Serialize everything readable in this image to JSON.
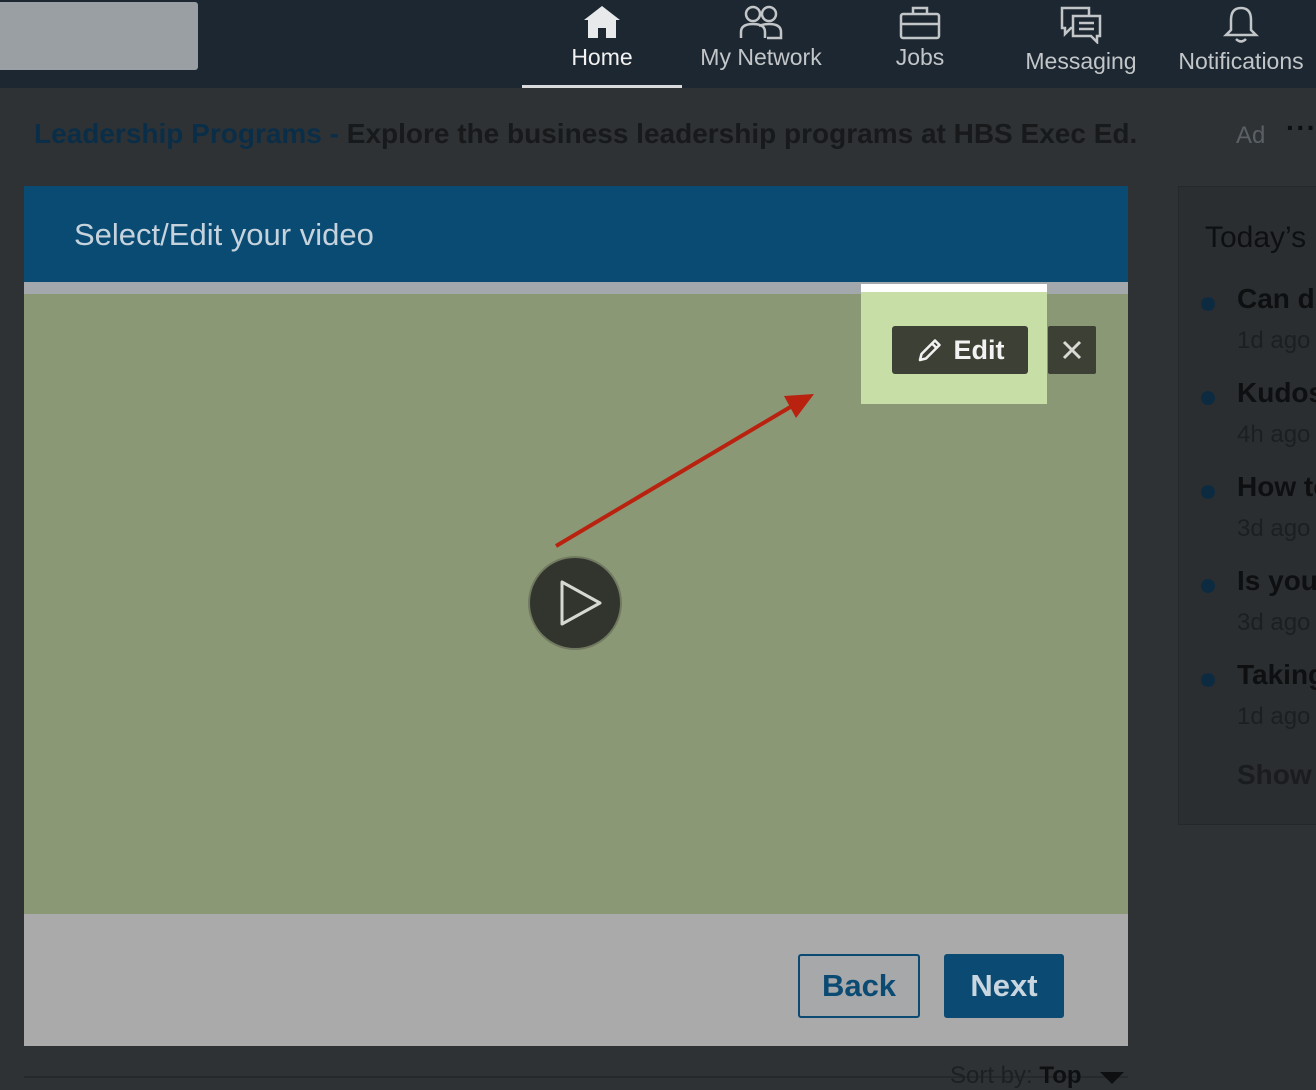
{
  "nav": {
    "items": [
      {
        "label": "Home",
        "icon": "home-icon",
        "active": true
      },
      {
        "label": "My Network",
        "icon": "network-icon"
      },
      {
        "label": "Jobs",
        "icon": "briefcase-icon"
      },
      {
        "label": "Messaging",
        "icon": "messaging-icon"
      },
      {
        "label": "Notifications",
        "icon": "bell-icon"
      }
    ]
  },
  "ad": {
    "link": "Leadership Programs",
    "separator": " - ",
    "text": "Explore the business leadership programs at HBS Exec Ed.",
    "label": "Ad",
    "more": "···"
  },
  "modal": {
    "title": "Select/Edit your video",
    "edit_label": "Edit",
    "back_label": "Back",
    "next_label": "Next"
  },
  "sidebar": {
    "title": "Today’s",
    "items": [
      {
        "headline": "Can dr",
        "meta": "1d ago"
      },
      {
        "headline": "Kudos",
        "meta": "4h ago"
      },
      {
        "headline": "How to",
        "meta": "3d ago"
      },
      {
        "headline": "Is you",
        "meta": "3d ago"
      },
      {
        "headline": "Taking",
        "meta": "1d ago"
      }
    ],
    "show_label": "Show"
  },
  "sort": {
    "label": "Sort by:",
    "value": "Top"
  },
  "colors": {
    "nav_bg": "#1c2731",
    "modal_header": "#0a4b74",
    "video_bg": "#8b9876",
    "highlight": "#c7dfa6",
    "arrow": "#b8220f"
  }
}
